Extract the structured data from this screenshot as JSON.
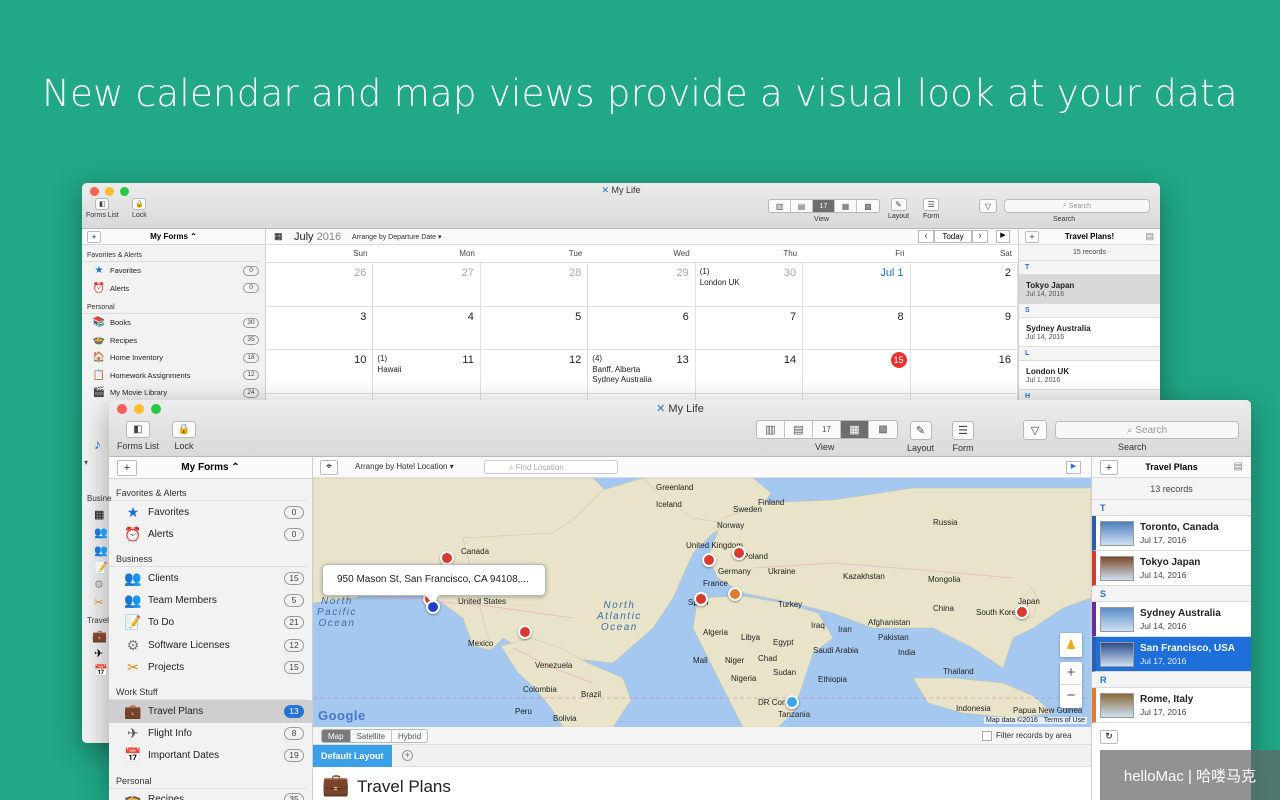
{
  "headline": "New calendar and map views provide a visual look at your data",
  "back_window": {
    "title": "My Life",
    "toolbar": {
      "forms_list": "Forms List",
      "lock": "Lock",
      "view": "View",
      "layout": "Layout",
      "form": "Form",
      "search_placeholder": "Search",
      "search_label": "Search"
    },
    "sidebar": {
      "header": "My Forms",
      "sections": [
        {
          "title": "Favorites & Alerts",
          "items": [
            {
              "label": "Favorites",
              "count": "0",
              "icon": "★",
              "color": "#1a6fd6"
            },
            {
              "label": "Alerts",
              "count": "0",
              "icon": "⏰",
              "color": "#1a6fd6"
            }
          ]
        },
        {
          "title": "Personal",
          "items": [
            {
              "label": "Books",
              "count": "30",
              "icon": "📚",
              "color": "#8a3"
            },
            {
              "label": "Recipes",
              "count": "35",
              "icon": "🍲",
              "color": "#c55"
            },
            {
              "label": "Home Inventory",
              "count": "18",
              "icon": "🏠",
              "color": "#c33"
            },
            {
              "label": "Homework Assignments",
              "count": "12",
              "icon": "📋",
              "color": "#963"
            },
            {
              "label": "My Movie Library",
              "count": "24",
              "icon": "🎬",
              "color": "#333"
            }
          ]
        }
      ]
    },
    "calendar": {
      "month": "July",
      "year": "2016",
      "arrange": "Arrange by Departure Date",
      "today": "Today",
      "weekdays": [
        "Sun",
        "Mon",
        "Tue",
        "Wed",
        "Thu",
        "Fri",
        "Sat"
      ],
      "weeks": [
        [
          {
            "d": "26",
            "dim": true
          },
          {
            "d": "27",
            "dim": true
          },
          {
            "d": "28",
            "dim": true
          },
          {
            "d": "29",
            "dim": true
          },
          {
            "d": "30",
            "dim": true,
            "count": "(1)",
            "events": [
              "London UK"
            ]
          },
          {
            "d": "Jul 1",
            "blue": true
          },
          {
            "d": "2"
          }
        ],
        [
          {
            "d": "3"
          },
          {
            "d": "4"
          },
          {
            "d": "5"
          },
          {
            "d": "6"
          },
          {
            "d": "7"
          },
          {
            "d": "8"
          },
          {
            "d": "9"
          }
        ],
        [
          {
            "d": "10"
          },
          {
            "d": "11",
            "count": "(1)",
            "events": [
              "Hawaii"
            ]
          },
          {
            "d": "12"
          },
          {
            "d": "13",
            "count": "(4)",
            "events": [
              "Banff, Alberta",
              "Sydney Australia"
            ]
          },
          {
            "d": "14"
          },
          {
            "d": "15",
            "today": true
          },
          {
            "d": "16"
          }
        ]
      ]
    },
    "records": {
      "title": "Travel Plans!",
      "count": "15 records",
      "groups": [
        {
          "letter": "T",
          "items": [
            {
              "name": "Tokyo Japan",
              "date": "Jul 14, 2016",
              "sel": true
            }
          ]
        },
        {
          "letter": "S",
          "items": [
            {
              "name": "Sydney Australia",
              "date": "Jul 14, 2016"
            }
          ]
        },
        {
          "letter": "L",
          "items": [
            {
              "name": "London UK",
              "date": "Jul 1, 2016"
            }
          ]
        },
        {
          "letter": "H",
          "items": []
        }
      ]
    },
    "fragments": {
      "business": "Busine",
      "travel": "Travel"
    }
  },
  "front_window": {
    "title": "My Life",
    "toolbar": {
      "forms_list": "Forms List",
      "lock": "Lock",
      "view": "View",
      "layout": "Layout",
      "form": "Form",
      "search_placeholder": "Search",
      "search_label": "Search"
    },
    "sidebar": {
      "header": "My Forms",
      "sections": [
        {
          "title": "Favorites & Alerts",
          "items": [
            {
              "label": "Favorites",
              "count": "0",
              "icon": "★",
              "color": "#1a6fd6"
            },
            {
              "label": "Alerts",
              "count": "0",
              "icon": "⏰",
              "color": "#1a6fd6"
            }
          ]
        },
        {
          "title": "Business",
          "items": [
            {
              "label": "Clients",
              "count": "15",
              "icon": "👥",
              "color": "#222"
            },
            {
              "label": "Team Members",
              "count": "5",
              "icon": "👥",
              "color": "#222"
            },
            {
              "label": "To Do",
              "count": "21",
              "icon": "📝",
              "color": "#c33"
            },
            {
              "label": "Software Licenses",
              "count": "12",
              "icon": "⚙",
              "color": "#777"
            },
            {
              "label": "Projects",
              "count": "15",
              "icon": "✂",
              "color": "#c80"
            }
          ]
        },
        {
          "title": "Work Stuff",
          "items": [
            {
              "label": "Travel Plans",
              "count": "13",
              "icon": "💼",
              "color": "#a52",
              "sel": true
            },
            {
              "label": "Flight Info",
              "count": "8",
              "icon": "✈",
              "color": "#555"
            },
            {
              "label": "Important Dates",
              "count": "19",
              "icon": "📅",
              "color": "#c33"
            }
          ]
        },
        {
          "title": "Personal",
          "items": [
            {
              "label": "Recipes",
              "count": "35",
              "icon": "🍲",
              "color": "#999"
            }
          ]
        }
      ]
    },
    "map": {
      "arrange": "Arrange by Hotel Location",
      "find_placeholder": "Find Location",
      "callout": "950 Mason St, San Francisco, CA  94108,...",
      "tabs": [
        "Map",
        "Satellite",
        "Hybrid"
      ],
      "active_tab": "Map",
      "filter_label": "Filter records by area",
      "attribution": "Map data ©2016",
      "terms": "Terms of Use",
      "google": "Google",
      "oceans": [
        {
          "text": "North\nPacific\nOcean"
        },
        {
          "text": "North\nAtlantic\nOcean"
        }
      ],
      "labels": [
        "Canada",
        "United States",
        "Mexico",
        "Venezuela",
        "Colombia",
        "Peru",
        "Brazil",
        "Bolivia",
        "Greenland",
        "Iceland",
        "Sweden",
        "Finland",
        "Norway",
        "United Kingdom",
        "Germany",
        "Poland",
        "Ukraine",
        "France",
        "Spain",
        "Turkey",
        "Kazakhstan",
        "Mongolia",
        "China",
        "Japan",
        "South Korea",
        "Afghanistan",
        "Pakistan",
        "India",
        "Iran",
        "Iraq",
        "Egypt",
        "Libya",
        "Algeria",
        "Mali",
        "Niger",
        "Chad",
        "Sudan",
        "Nigeria",
        "Ethiopia",
        "DR Congo",
        "Tanzania",
        "Thailand",
        "Indonesia",
        "Papua New Guinea",
        "Saudi Arabia",
        "Russia"
      ],
      "pins": [
        {
          "color": "#d73a2f"
        },
        {
          "color": "#d73a2f"
        },
        {
          "color": "#1f3fd0"
        },
        {
          "color": "#d73a2f"
        },
        {
          "color": "#d73a2f"
        },
        {
          "color": "#d73a2f"
        },
        {
          "color": "#d73a2f"
        },
        {
          "color": "#e07a2e"
        },
        {
          "color": "#d73a2f"
        },
        {
          "color": "#3ba7e6"
        }
      ]
    },
    "layout_tab": "Default Layout",
    "form_title": "Travel Plans",
    "records": {
      "title": "Travel Plans",
      "count": "13 records",
      "groups": [
        {
          "letter": "T",
          "items": [
            {
              "name": "Toronto, Canada",
              "date": "Jul 17, 2016",
              "bar": "#2a5fb0"
            },
            {
              "name": "Tokyo Japan",
              "date": "Jul 14, 2016",
              "bar": "#d73a2f"
            }
          ]
        },
        {
          "letter": "S",
          "items": [
            {
              "name": "Sydney Australia",
              "date": "Jul 14, 2016",
              "bar": "#6a2a9e"
            },
            {
              "name": "San Francisco, USA",
              "date": "Jul 17, 2016",
              "bar": "#2a5fb0",
              "sel": true
            }
          ]
        },
        {
          "letter": "R",
          "items": [
            {
              "name": "Rome, Italy",
              "date": "Jul 17, 2016",
              "bar": "#e07a2e"
            }
          ]
        }
      ]
    }
  },
  "watermark": "helloMac | 哈喽马克"
}
